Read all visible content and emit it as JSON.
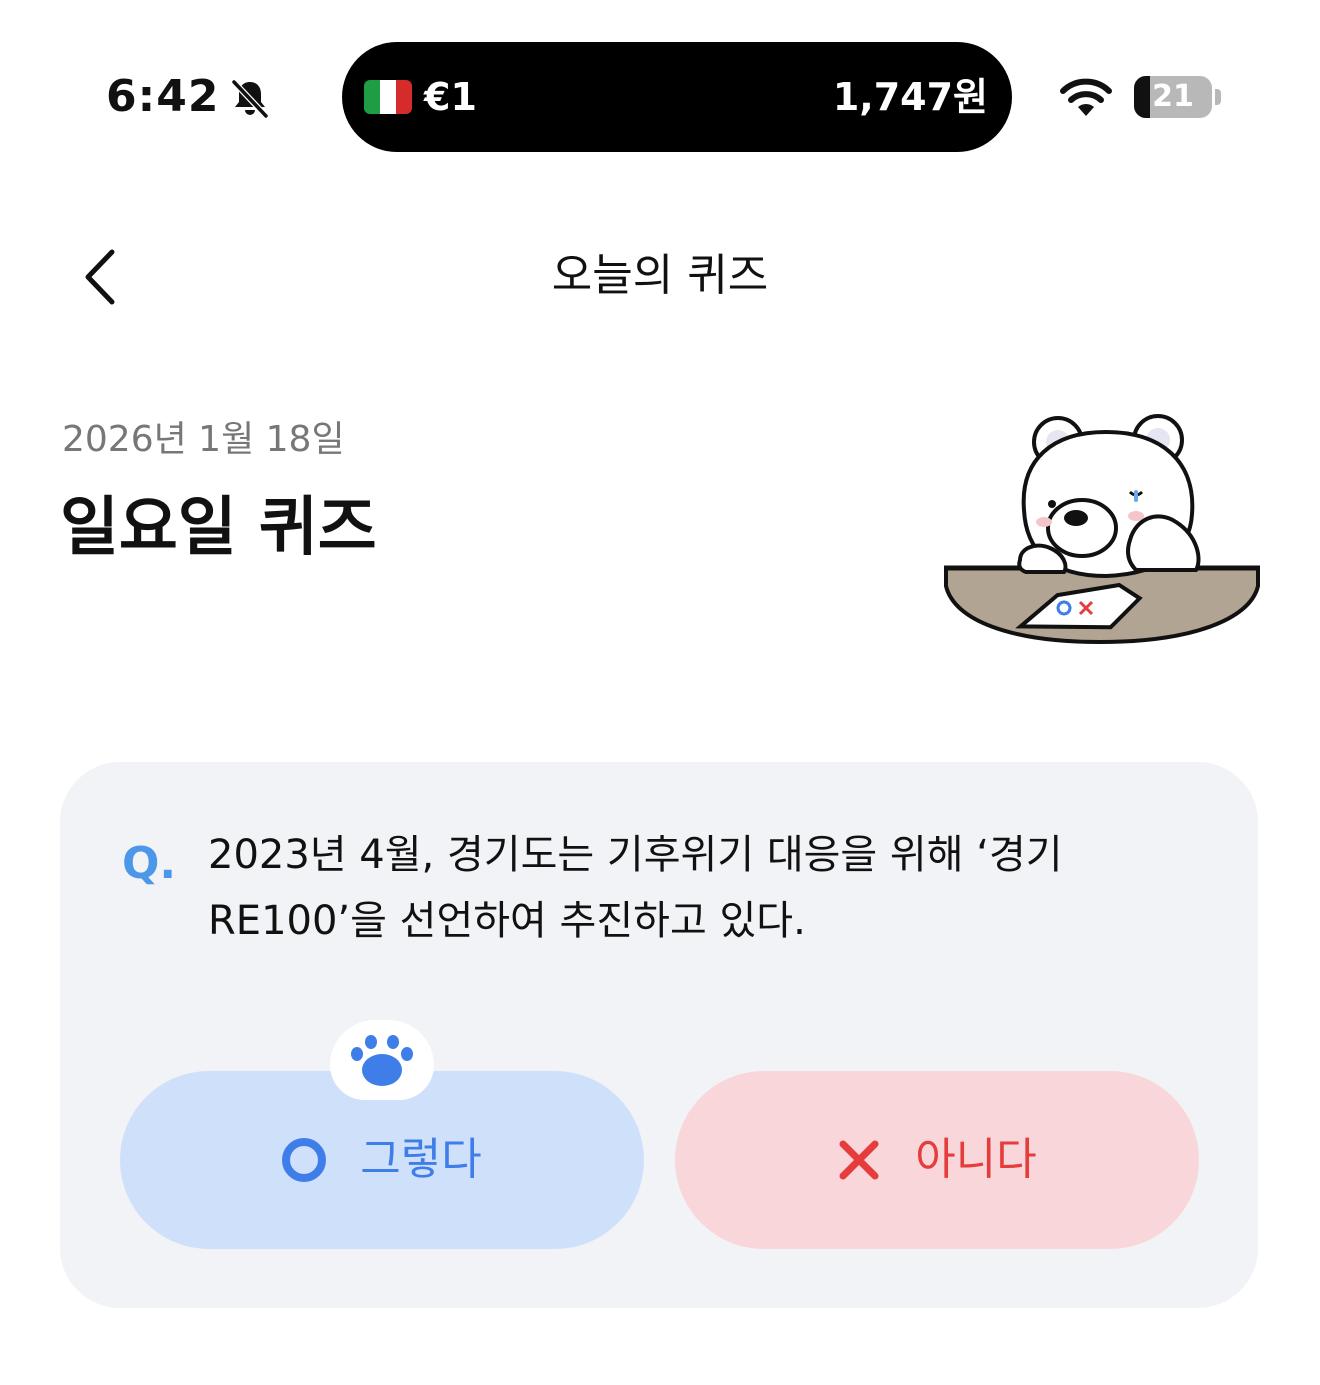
{
  "status_bar": {
    "time": "6:42",
    "island_left": "€1",
    "island_right": "1,747원",
    "battery_level": "21",
    "battery_fraction": 0.21,
    "icons": [
      "bell-muted-icon",
      "italy-flag-icon",
      "wifi-icon",
      "battery-icon"
    ]
  },
  "header": {
    "title": "오늘의 퀴즈",
    "back_icon": "chevron-left-icon"
  },
  "hero": {
    "date": "2026년 1월 18일",
    "heading": "일요일 퀴즈",
    "illustration": "polar-bear-ox-sheet-illustration"
  },
  "question": {
    "marker": "Q.",
    "text": "2023년 4월, 경기도는 기후위기 대응을 위해 ‘경기 RE100’을 선언하여 추진하고 있다."
  },
  "answers": {
    "yes_label": "그렇다",
    "no_label": "아니다",
    "yes_icon": "circle-o-icon",
    "no_icon": "x-mark-icon",
    "paw_icon": "paw-icon"
  },
  "colors": {
    "accent_blue": "#3f7ee8",
    "accent_red": "#e53c3c",
    "yes_bg": "#cfe0fa",
    "no_bg": "#f8d6da",
    "card_bg": "#f2f3f6"
  }
}
